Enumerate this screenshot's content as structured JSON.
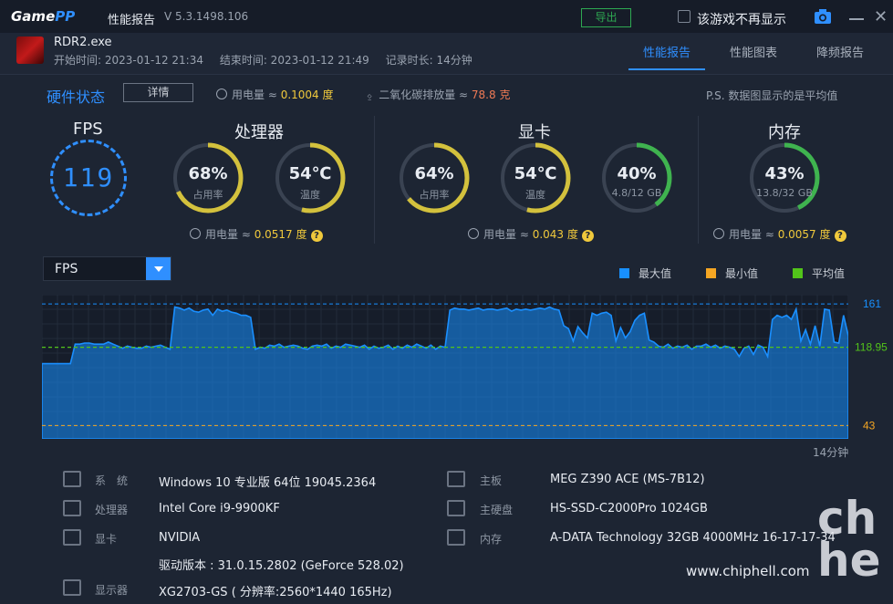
{
  "titlebar": {
    "logo_main": "Game",
    "logo_accent": "PP",
    "title": "性能报告",
    "version": "V 5.3.1498.106",
    "export_label": "导出",
    "no_display_label": "该游戏不再显示"
  },
  "header": {
    "game": "RDR2.exe",
    "start": "开始时间: 2023-01-12 21:34",
    "end": "结束时间: 2023-01-12 21:49",
    "duration": "记录时长: 14分钟",
    "tabs": [
      "性能报告",
      "性能图表",
      "降频报告"
    ]
  },
  "hw": {
    "title": "硬件状态",
    "detail": "详情",
    "power_label": "用电量 ≈",
    "power_value": "0.1004 度",
    "co2_label": "二氧化碳排放量 ≈",
    "co2_value": "78.8 克",
    "note": "P.S. 数据图显示的是平均值"
  },
  "stats": {
    "fps_title": "FPS",
    "fps_value": "119",
    "cpu_title": "处理器",
    "cpu_usage": "68%",
    "cpu_usage_label": "占用率",
    "cpu_temp": "54℃",
    "cpu_temp_label": "温度",
    "cpu_power": "0.0517 度",
    "gpu_title": "显卡",
    "gpu_usage": "64%",
    "gpu_usage_label": "占用率",
    "gpu_temp": "54℃",
    "gpu_temp_label": "温度",
    "gpu_mem": "40%",
    "gpu_mem_label": "4.8/12 GB",
    "gpu_power": "0.043 度",
    "mem_title": "内存",
    "mem_usage": "43%",
    "mem_usage_label": "13.8/32 GB",
    "mem_power": "0.0057 度",
    "power_prefix": "用电量 ≈",
    "q": "?"
  },
  "gauge_levels": {
    "cpu_usage": 0.68,
    "cpu_temp": 0.54,
    "gpu_usage": 0.64,
    "gpu_temp": 0.54,
    "gpu_mem": 0.4,
    "mem_usage": 0.43
  },
  "colors": {
    "accent": "#2f8fff",
    "gauge_yellow": "#d3c13d",
    "gauge_green": "#3fb34f",
    "max": "#1890ff",
    "min": "#f5a623",
    "avg": "#52c41a"
  },
  "chart_select": "FPS",
  "legend": {
    "max": "最大值",
    "min": "最小值",
    "avg": "平均值"
  },
  "chart_data": {
    "type": "area",
    "series": [
      {
        "name": "FPS",
        "values": [
          103,
          103,
          103,
          103,
          103,
          103,
          103,
          122,
          122,
          123,
          123,
          122,
          122,
          122,
          124,
          122,
          120,
          118,
          120,
          119,
          118,
          118,
          120,
          119,
          120,
          121,
          119,
          117,
          158,
          157,
          155,
          157,
          154,
          153,
          155,
          156,
          150,
          156,
          154,
          155,
          153,
          152,
          150,
          150,
          148,
          117,
          119,
          118,
          121,
          120,
          122,
          119,
          120,
          121,
          120,
          118,
          117,
          120,
          121,
          120,
          122,
          118,
          120,
          119,
          122,
          121,
          120,
          119,
          121,
          117,
          120,
          118,
          119,
          121,
          117,
          120,
          118,
          121,
          119,
          122,
          120,
          118,
          121,
          117,
          120,
          119,
          155,
          157,
          156,
          156,
          155,
          156,
          157,
          155,
          156,
          156,
          155,
          156,
          157,
          154,
          156,
          155,
          156,
          155,
          156,
          157,
          156,
          158,
          156,
          155,
          140,
          137,
          125,
          139,
          133,
          128,
          152,
          150,
          152,
          153,
          150,
          125,
          138,
          128,
          134,
          145,
          150,
          152,
          126,
          124,
          120,
          119,
          122,
          118,
          120,
          119,
          121,
          117,
          120,
          120,
          122,
          119,
          121,
          118,
          120,
          119,
          117,
          110,
          118,
          120,
          112,
          121,
          119,
          110,
          146,
          150,
          148,
          150,
          146,
          156,
          125,
          136,
          122,
          140,
          120,
          156,
          155,
          124,
          123,
          150,
          130
        ]
      }
    ],
    "reference_lines": {
      "max": 161,
      "avg": 118.95,
      "min": 43
    },
    "ylim": [
      30,
      170
    ],
    "x_end_label": "14分钟"
  },
  "specs": {
    "os_key": "系　统",
    "os": "Windows 10 专业版 64位 19045.2364",
    "cpu_key": "处理器",
    "cpu": "Intel Core i9-9900KF",
    "gpu_key": "显卡",
    "gpu": "NVIDIA",
    "driver": "驱动版本 : 31.0.15.2802 (GeForce 528.02)",
    "monitor_key": "显示器",
    "monitor": "XG2703-GS ( 分辨率:2560*1440 165Hz)",
    "board_key": "主板",
    "board": "MEG Z390 ACE (MS-7B12)",
    "disk_key": "主硬盘",
    "disk": "HS-SSD-C2000Pro 1024GB",
    "ram_key": "内存",
    "ram": "A-DATA Technology 32GB 4000MHz 16-17-17-34"
  },
  "watermark": {
    "url": "www.chiphell.com",
    "logo": "chip hell"
  }
}
